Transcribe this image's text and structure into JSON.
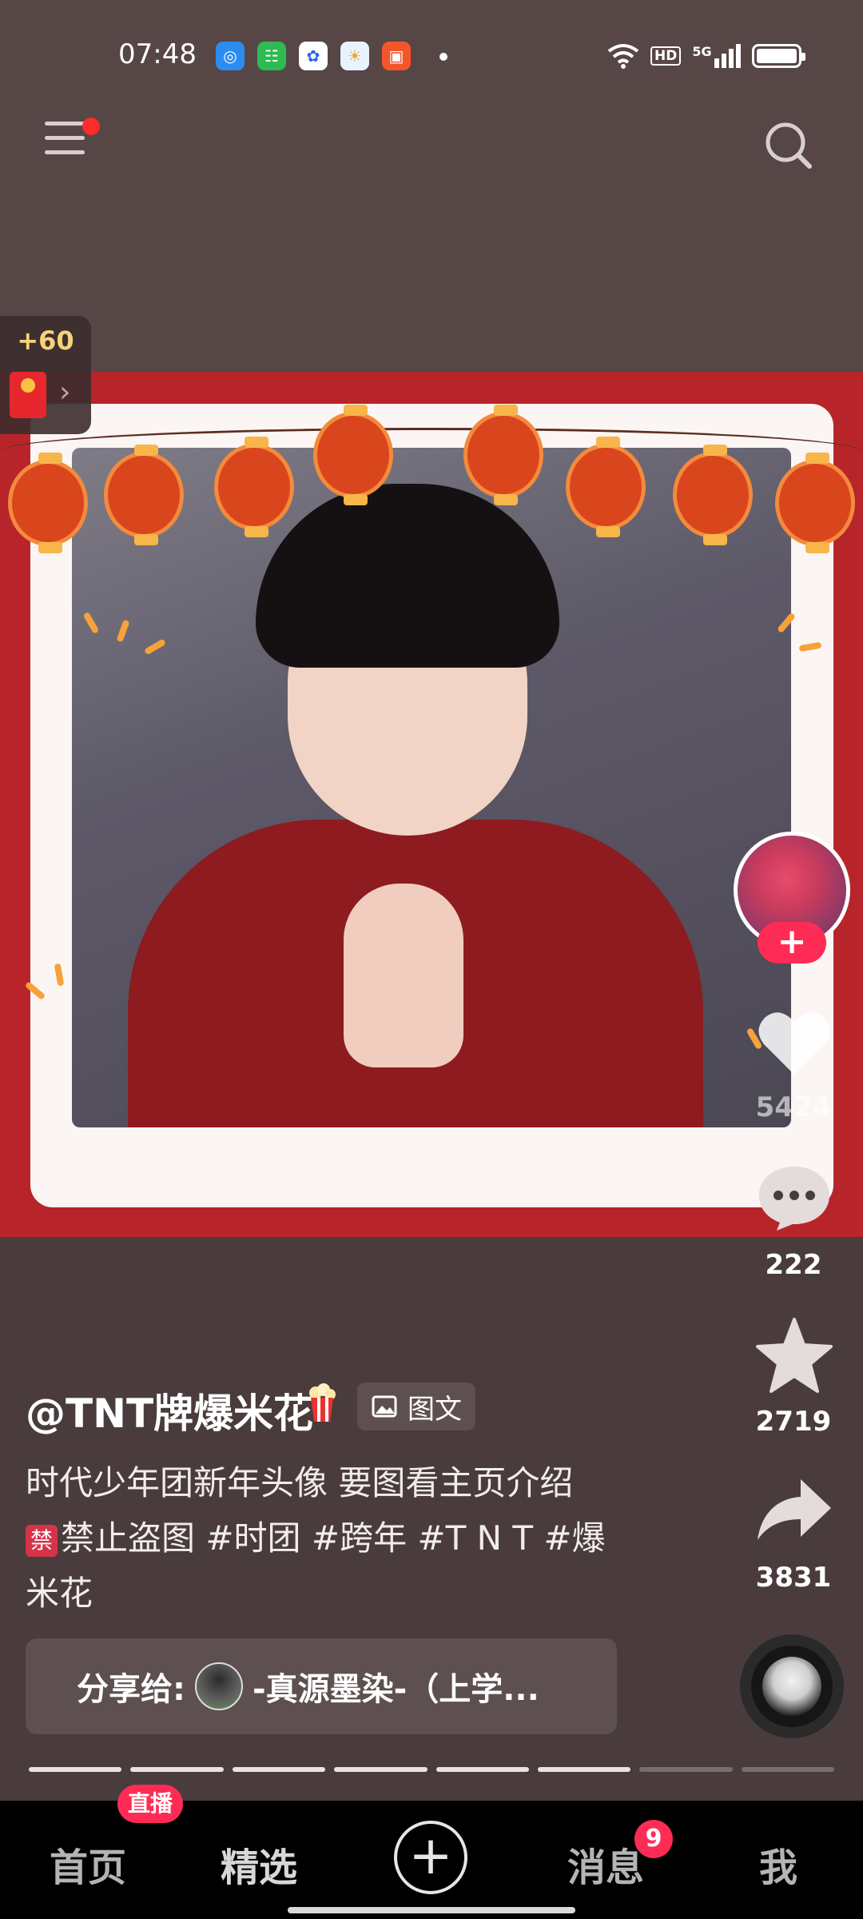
{
  "status_bar": {
    "time": "07:48",
    "icons": [
      "browser-app-icon",
      "wechat-app-icon",
      "baidu-app-icon",
      "weather-app-icon",
      "video-app-icon"
    ],
    "hd_label": "HD",
    "network_label": "5G"
  },
  "header": {
    "menu_icon": "hamburger-menu-icon",
    "search_icon": "search-icon"
  },
  "reward": {
    "points": "+60",
    "arrow": "›"
  },
  "actions": {
    "follow_label": "+",
    "like_count": "5424",
    "comment_count": "222",
    "favorite_count": "2719",
    "share_count": "3831"
  },
  "caption": {
    "author": "@TNT牌爆米花",
    "post_type": "图文",
    "description_line1": "时代少年团新年头像 要图看主页介绍",
    "forbid_glyph": "禁",
    "description_line2": "禁止盗图 #时团 #跨年 #T N T #爆",
    "description_line3": "米花"
  },
  "share_bar": {
    "label": "分享给:",
    "target": "-真源墨染-（上学..."
  },
  "progress": {
    "total_segments": 8,
    "completed_segments": 6
  },
  "bottom_nav": {
    "home": "首页",
    "live_badge": "直播",
    "selected": "精选",
    "publish": "+",
    "messages": "消息",
    "messages_badge": "9",
    "me": "我"
  },
  "colors": {
    "background": "#4a3c3c",
    "accent": "#fe2c55",
    "image_red": "#b7252b"
  }
}
